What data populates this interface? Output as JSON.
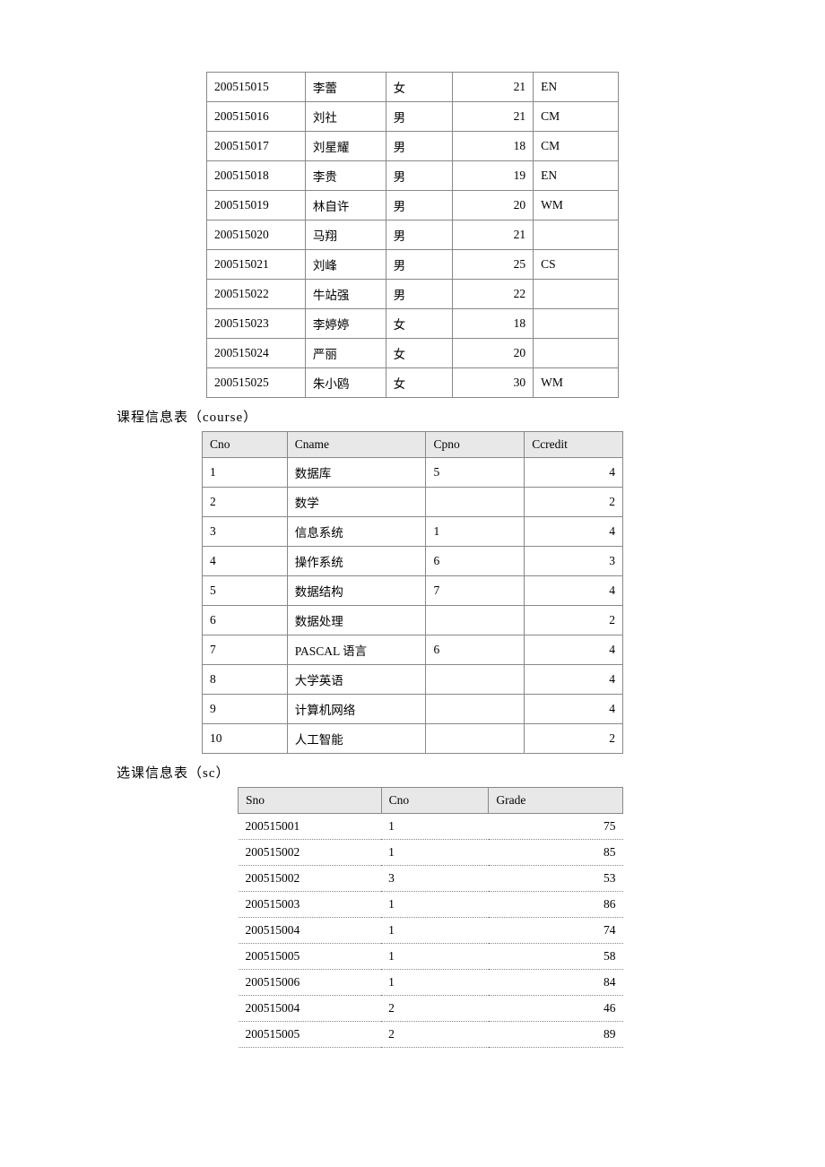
{
  "student": {
    "rows": [
      {
        "sno": "200515015",
        "sname": "李蕾",
        "ssex": "女",
        "sage": 21,
        "sdept": "EN"
      },
      {
        "sno": "200515016",
        "sname": "刘社",
        "ssex": "男",
        "sage": 21,
        "sdept": "CM"
      },
      {
        "sno": "200515017",
        "sname": "刘星耀",
        "ssex": "男",
        "sage": 18,
        "sdept": "CM"
      },
      {
        "sno": "200515018",
        "sname": "李贵",
        "ssex": "男",
        "sage": 19,
        "sdept": "EN"
      },
      {
        "sno": "200515019",
        "sname": "林自许",
        "ssex": "男",
        "sage": 20,
        "sdept": "WM"
      },
      {
        "sno": "200515020",
        "sname": "马翔",
        "ssex": "男",
        "sage": 21,
        "sdept": ""
      },
      {
        "sno": "200515021",
        "sname": "刘峰",
        "ssex": "男",
        "sage": 25,
        "sdept": "CS"
      },
      {
        "sno": "200515022",
        "sname": "牛站强",
        "ssex": "男",
        "sage": 22,
        "sdept": ""
      },
      {
        "sno": "200515023",
        "sname": "李婷婷",
        "ssex": "女",
        "sage": 18,
        "sdept": ""
      },
      {
        "sno": "200515024",
        "sname": "严丽",
        "ssex": "女",
        "sage": 20,
        "sdept": ""
      },
      {
        "sno": "200515025",
        "sname": "朱小鸥",
        "ssex": "女",
        "sage": 30,
        "sdept": "WM"
      }
    ]
  },
  "course": {
    "caption": "课程信息表（course）",
    "headers": {
      "cno": "Cno",
      "cname": "Cname",
      "cpno": "Cpno",
      "ccredit": "Ccredit"
    },
    "rows": [
      {
        "cno": "1",
        "cname": "数据库",
        "cpno": "5",
        "ccredit": 4
      },
      {
        "cno": "2",
        "cname": "数学",
        "cpno": "",
        "ccredit": 2
      },
      {
        "cno": "3",
        "cname": "信息系统",
        "cpno": "1",
        "ccredit": 4
      },
      {
        "cno": "4",
        "cname": "操作系统",
        "cpno": "6",
        "ccredit": 3
      },
      {
        "cno": "5",
        "cname": "数据结构",
        "cpno": "7",
        "ccredit": 4
      },
      {
        "cno": "6",
        "cname": "数据处理",
        "cpno": "",
        "ccredit": 2
      },
      {
        "cno": "7",
        "cname": "PASCAL 语言",
        "cpno": "6",
        "ccredit": 4
      },
      {
        "cno": "8",
        "cname": "大学英语",
        "cpno": "",
        "ccredit": 4
      },
      {
        "cno": "9",
        "cname": "计算机网络",
        "cpno": "",
        "ccredit": 4
      },
      {
        "cno": "10",
        "cname": "人工智能",
        "cpno": "",
        "ccredit": 2
      }
    ]
  },
  "sc": {
    "caption": "选课信息表（sc）",
    "headers": {
      "sno": "Sno",
      "cno": "Cno",
      "grade": "Grade"
    },
    "rows": [
      {
        "sno": "200515001",
        "cno": "1",
        "grade": 75
      },
      {
        "sno": "200515002",
        "cno": "1",
        "grade": 85
      },
      {
        "sno": "200515002",
        "cno": "3",
        "grade": 53
      },
      {
        "sno": "200515003",
        "cno": "1",
        "grade": 86
      },
      {
        "sno": "200515004",
        "cno": "1",
        "grade": 74
      },
      {
        "sno": "200515005",
        "cno": "1",
        "grade": 58
      },
      {
        "sno": "200515006",
        "cno": "1",
        "grade": 84
      },
      {
        "sno": "200515004",
        "cno": "2",
        "grade": 46
      },
      {
        "sno": "200515005",
        "cno": "2",
        "grade": 89
      }
    ]
  }
}
